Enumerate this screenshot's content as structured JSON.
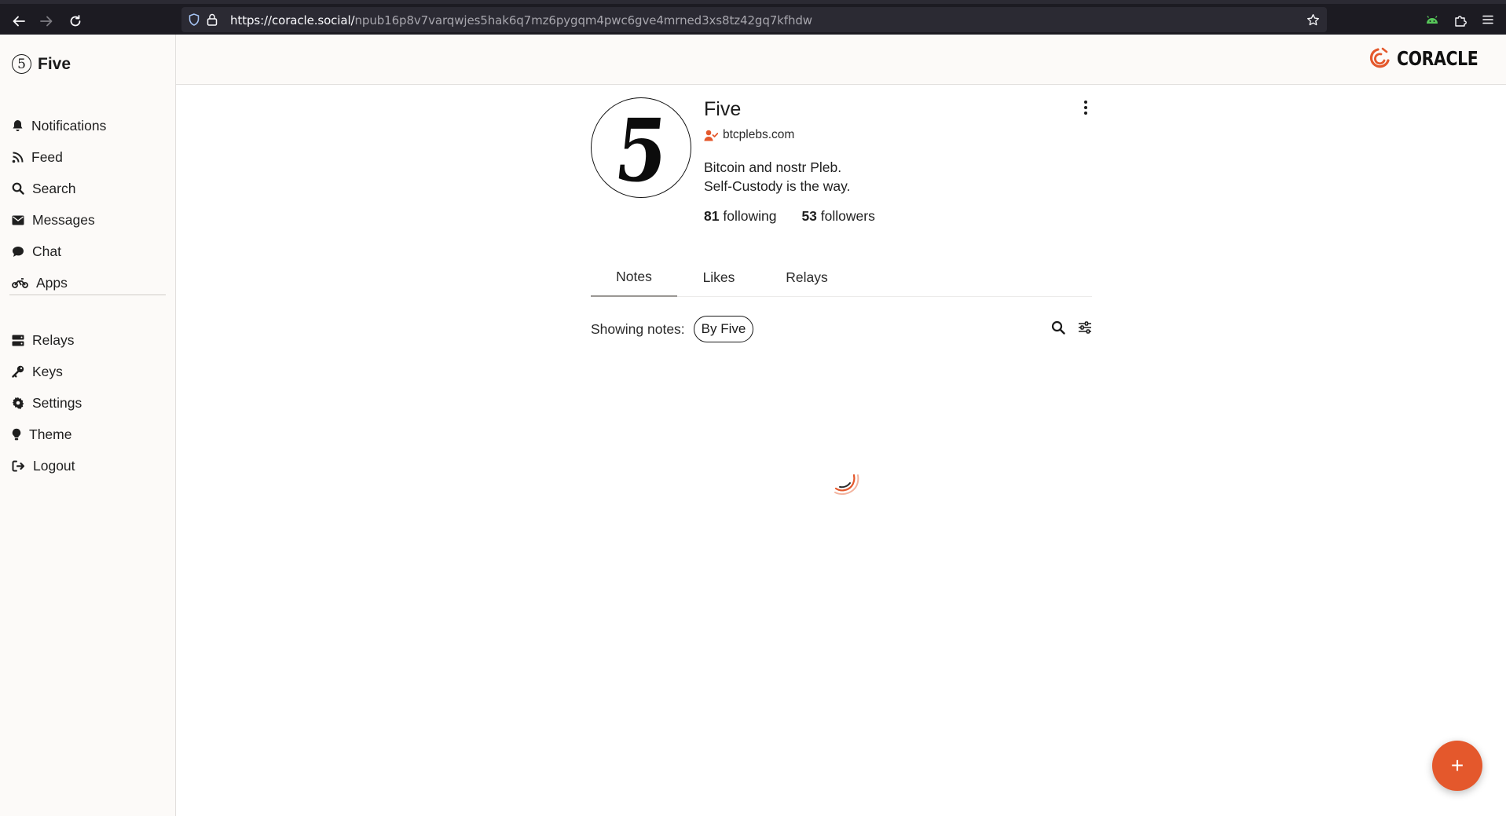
{
  "browser": {
    "url_host": "https://coracle.social/",
    "url_path": "npub16p8v7varqwjes5hak6q7mz6pygqm4pwc6gve4mrned3xs8tz42gq7kfhdw"
  },
  "sidebar": {
    "brand_name": "Five",
    "brand_glyph": "5",
    "primary_items": [
      {
        "label": "Notifications",
        "icon": "bell-icon"
      },
      {
        "label": "Feed",
        "icon": "rss-icon"
      },
      {
        "label": "Search",
        "icon": "search-icon"
      },
      {
        "label": "Messages",
        "icon": "envelope-icon"
      },
      {
        "label": "Chat",
        "icon": "chat-bubble-icon"
      },
      {
        "label": "Apps",
        "icon": "motorcycle-icon"
      }
    ],
    "secondary_items": [
      {
        "label": "Relays",
        "icon": "server-icon"
      },
      {
        "label": "Keys",
        "icon": "key-icon"
      },
      {
        "label": "Settings",
        "icon": "gear-icon"
      },
      {
        "label": "Theme",
        "icon": "lightbulb-icon"
      },
      {
        "label": "Logout",
        "icon": "logout-icon"
      }
    ]
  },
  "header": {
    "logo_text": "CORACLE"
  },
  "profile": {
    "avatar_glyph": "5",
    "name": "Five",
    "nip05": "btcplebs.com",
    "about_line1": "Bitcoin and nostr Pleb.",
    "about_line2": "Self-Custody is the way.",
    "following_count": "81",
    "following_label": "following",
    "followers_count": "53",
    "followers_label": "followers"
  },
  "tabs": [
    {
      "label": "Notes",
      "active": true
    },
    {
      "label": "Likes",
      "active": false
    },
    {
      "label": "Relays",
      "active": false
    }
  ],
  "filter": {
    "label": "Showing notes:",
    "pill": "By Five"
  },
  "fab": {
    "label": "+"
  },
  "colors": {
    "accent": "#e4582c",
    "sidebar_bg": "#fcfaf8",
    "browser_bg": "#1c1b22"
  }
}
